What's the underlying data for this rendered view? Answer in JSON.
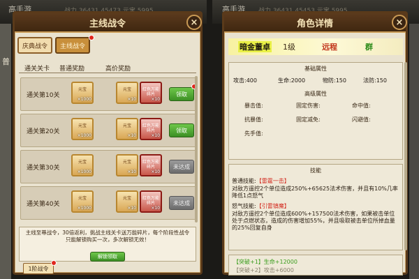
{
  "background": {
    "watermark_left": "高手游",
    "watermark_right": "高手游",
    "stats_left": "战力 36431   45473  元宝 5995",
    "stats_right": "战力 36431   45453  元宝 5995",
    "edge_text": "普"
  },
  "left_panel": {
    "title": "主线战令",
    "close_glyph": "×",
    "tabs": [
      {
        "label": "庆典战令",
        "active": false
      },
      {
        "label": "主线战令",
        "active": true
      }
    ],
    "columns": [
      "通关关卡",
      "普通奖励",
      "高价奖励"
    ],
    "rows": [
      {
        "stage": "通关第10关",
        "normal": {
          "name": "元宝",
          "count": "×1000"
        },
        "premium": [
          {
            "name": "元宝",
            "count": "×10"
          },
          {
            "name": "红色万能碎片",
            "count": "×10"
          }
        ],
        "button": "领取",
        "state": "claim"
      },
      {
        "stage": "通关第20关",
        "normal": {
          "name": "元宝",
          "count": "×1000"
        },
        "premium": [
          {
            "name": "元宝",
            "count": "×10"
          },
          {
            "name": "红色万能碎片",
            "count": "×10"
          }
        ],
        "button": "领取",
        "state": "claim"
      },
      {
        "stage": "通关第30关",
        "normal": {
          "name": "元宝",
          "count": "×1000"
        },
        "premium": [
          {
            "name": "元宝",
            "count": "×10"
          },
          {
            "name": "红色万能碎片",
            "count": "×10"
          }
        ],
        "button": "未达成",
        "state": "locked"
      },
      {
        "stage": "通关第40关",
        "normal": {
          "name": "元宝",
          "count": "×1000"
        },
        "premium": [
          {
            "name": "元宝",
            "count": "×10"
          },
          {
            "name": "红色万能碎片",
            "count": "×10"
          }
        ],
        "button": "未达成",
        "state": "locked"
      }
    ],
    "description": "主线至尊战令，30倍返利，挑战主线关卡送万能碎片，每个阶段性战令只能解锁购买一次，多次解锁无效！",
    "unlock_button": "解锁领取",
    "stage_badge": "1阶战令"
  },
  "right_panel": {
    "title": "角色详情",
    "close_glyph": "×",
    "hero": {
      "name": "暗金董卓",
      "level": "1级",
      "class": "远程",
      "group": "群"
    },
    "basic_title": "基础属性",
    "basic": [
      "攻击:400",
      "生命:2000",
      "物防:150",
      "法防:150"
    ],
    "advanced_title": "高级属性",
    "advanced": [
      "暴击值:",
      "固定伤害:",
      "命中值:",
      "抗暴值:",
      "固定减免:",
      "闪避值:",
      "先手值:"
    ],
    "skills_title": "技能",
    "normal_skill_prefix": "普通技能:",
    "normal_skill_name": "【雷霆一击】",
    "normal_skill_desc": "对敌方遥控2个单位造成250%+65625法术伤害，并且有10%几率降低1点怒气",
    "rage_skill_prefix": "怒气技能:",
    "rage_skill_name": "【引雷镇魔】",
    "rage_skill_desc": "对敌方遥控2个单位造成600%+157500法术伤害，如果被击单位处于点燃状态，造成的伤害增加55%，并且吸取被击单位所掉血量的25%回复自身",
    "breakthroughs": [
      {
        "label": "【突破+1】生命+12000",
        "active": true
      },
      {
        "label": "【突破+2】攻击+6000",
        "active": false
      }
    ]
  },
  "colors": {
    "accent_green": "#3c8f24",
    "accent_red": "#d32a1f",
    "panel_bg": "#e9e2cf",
    "header_brown": "#4a2f15"
  }
}
